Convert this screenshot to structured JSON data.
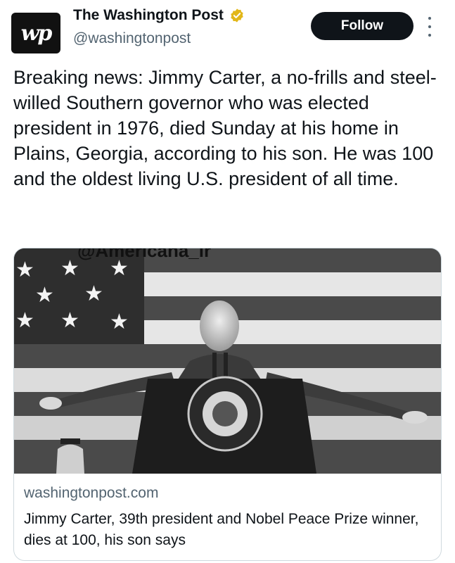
{
  "account": {
    "avatar_text": "wp",
    "name": "The Washington Post",
    "handle": "@washingtonpost",
    "verified_icon": "verified-badge-icon"
  },
  "actions": {
    "follow_label": "Follow",
    "more_icon": "more-options-icon"
  },
  "tweet": {
    "text": "Breaking news: Jimmy Carter, a no-frills and steel-willed Southern governor who was elected president in 1976, died Sunday at his home in Plains, Georgia, according to his son. He was 100 and the oldest living U.S. president of all time."
  },
  "watermark": "@Americana_ir",
  "link_card": {
    "domain": "washingtonpost.com",
    "headline": "Jimmy Carter, 39th president and Nobel Peace Prize winner, dies at 100, his son says"
  },
  "colors": {
    "text": "#0f1419",
    "secondary": "#536471",
    "badge": "#e2b719",
    "border": "#cfd9de"
  }
}
